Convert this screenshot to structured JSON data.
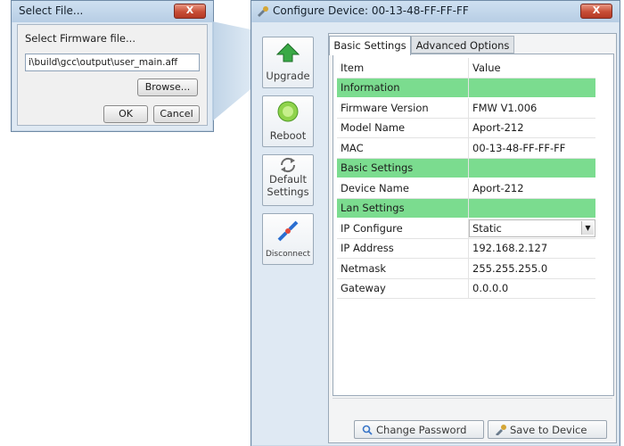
{
  "select_dialog": {
    "title": "Select File...",
    "close_label": "X",
    "prompt": "Select Firmware file...",
    "path_value": "i\\build\\gcc\\output\\user_main.aff",
    "browse_label": "Browse...",
    "ok_label": "OK",
    "cancel_label": "Cancel"
  },
  "configure_window": {
    "title": "Configure Device: 00-13-48-FF-FF-FF",
    "close_label": "X",
    "sidebar": [
      {
        "label": "Upgrade",
        "icon": "upgrade-arrow-icon"
      },
      {
        "label": "Reboot",
        "icon": "reboot-icon"
      },
      {
        "label": "Default\nSettings",
        "icon": "default-settings-icon"
      },
      {
        "label": "Disconnect",
        "icon": "disconnect-plug-icon"
      }
    ],
    "tabs": [
      {
        "label": "Basic Settings",
        "active": true
      },
      {
        "label": "Advanced Options",
        "active": false
      }
    ],
    "table": {
      "headers": [
        "Item",
        "Value"
      ],
      "rows": [
        {
          "type": "section",
          "item": "Information",
          "value": ""
        },
        {
          "type": "row",
          "item": "Firmware Version",
          "value": "FMW V1.006"
        },
        {
          "type": "row",
          "item": "Model Name",
          "value": "Aport-212"
        },
        {
          "type": "row",
          "item": "MAC",
          "value": "00-13-48-FF-FF-FF"
        },
        {
          "type": "section",
          "item": "Basic Settings",
          "value": ""
        },
        {
          "type": "row",
          "item": "Device Name",
          "value": "Aport-212"
        },
        {
          "type": "section",
          "item": "Lan Settings",
          "value": ""
        },
        {
          "type": "select",
          "item": "IP Configure",
          "value": "Static"
        },
        {
          "type": "row",
          "item": "IP Address",
          "value": "192.168.2.127"
        },
        {
          "type": "row",
          "item": "Netmask",
          "value": "255.255.255.0"
        },
        {
          "type": "row",
          "item": "Gateway",
          "value": "0.0.0.0"
        }
      ]
    },
    "buttons": {
      "change_password": "Change Password",
      "save_to_device": "Save to Device"
    }
  },
  "colors": {
    "section_row": "#7bdc8f",
    "title_bar": "#b7cde4",
    "close_button": "#c84d36"
  }
}
